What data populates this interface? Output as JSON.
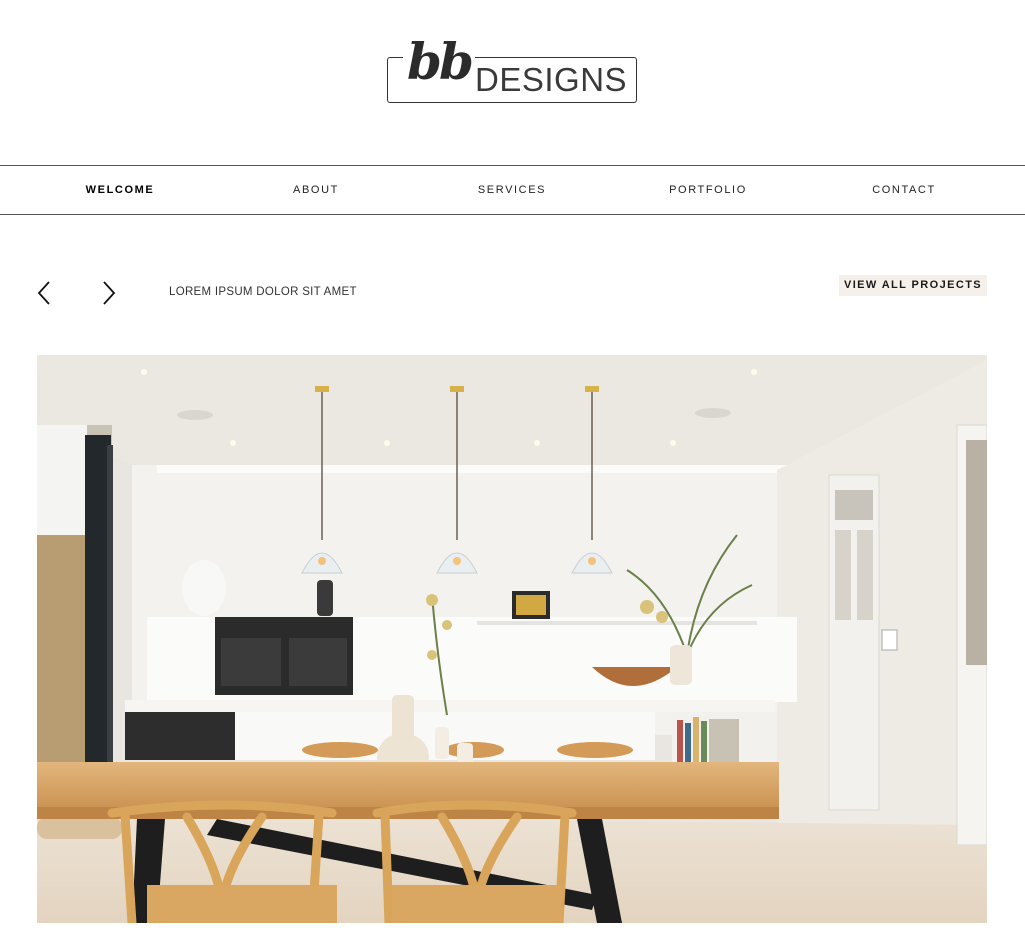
{
  "logo": {
    "script": "bb",
    "word": "DESIGNS"
  },
  "nav": {
    "items": [
      {
        "label": "WELCOME",
        "active": true
      },
      {
        "label": "ABOUT",
        "active": false
      },
      {
        "label": "SERVICES",
        "active": false
      },
      {
        "label": "PORTFOLIO",
        "active": false
      },
      {
        "label": "CONTACT",
        "active": false
      }
    ]
  },
  "project": {
    "prev_icon": "chevron-left-icon",
    "next_icon": "chevron-right-icon",
    "title": "LOREM IPSUM DOLOR SIT AMET",
    "view_all_label": "VIEW ALL PROJECTS"
  },
  "hero": {
    "subject": "kitchen-dining-interior-photo"
  },
  "colors": {
    "view_all_bg": "#f6f0ea",
    "text": "#1a1a1a",
    "rule": "#555555"
  }
}
